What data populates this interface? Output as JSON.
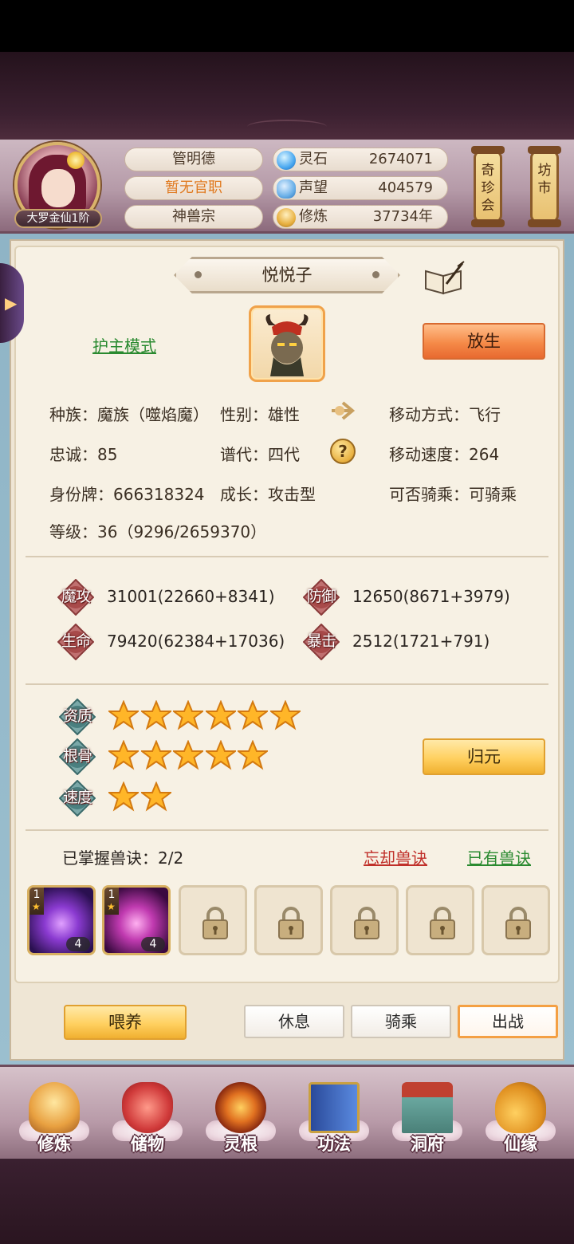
{
  "header": {
    "rank_badge": "大罗金仙1阶",
    "player_name": "管明德",
    "official_post": "暂无官职",
    "sect": "神兽宗",
    "resources": [
      {
        "icon": "spirit-stone-icon",
        "label": "灵石",
        "value": "2674071"
      },
      {
        "icon": "reputation-icon",
        "label": "声望",
        "value": "404579"
      },
      {
        "icon": "cultivation-icon",
        "label": "修炼",
        "value": "37734年"
      }
    ],
    "lantern_treasure": "奇珍会",
    "lantern_market": "坊市"
  },
  "pet": {
    "name": "悦悦子",
    "guard_mode": "护主模式",
    "release_label": "放生",
    "info": {
      "race": "种族：魔族（噬焰魔）",
      "gender": "性别：雄性",
      "move_type": "移动方式：飞行",
      "loyalty": "忠诚：85",
      "generation": "谱代：四代",
      "move_speed": "移动速度：264",
      "id_tag": "身份牌：666318324",
      "growth": "成长：攻击型",
      "rideable": "可否骑乘：可骑乘",
      "level": "等级：36（9296/2659370）"
    },
    "help_icon": "?",
    "stats": [
      {
        "badge": "魔攻",
        "value": "31001(22660+8341)"
      },
      {
        "badge": "防御",
        "value": "12650(8671+3979)"
      },
      {
        "badge": "生命",
        "value": "79420(62384+17036)"
      },
      {
        "badge": "暴击",
        "value": "2512(1721+791)"
      }
    ],
    "ratings": [
      {
        "badge": "资质",
        "stars": 6
      },
      {
        "badge": "根骨",
        "stars": 5
      },
      {
        "badge": "速度",
        "stars": 2
      }
    ],
    "return_label": "归元",
    "skills_learned": "已掌握兽诀：2/2",
    "forget_label": "忘却兽诀",
    "owned_label": "已有兽诀",
    "skills": [
      {
        "level": "1",
        "count": "4"
      },
      {
        "level": "1",
        "count": "4"
      }
    ],
    "locked_slots": 5
  },
  "actions": {
    "feed": "喂养",
    "rest": "休息",
    "ride": "骑乘",
    "battle": "出战"
  },
  "nav": [
    {
      "label": "修炼",
      "icon": "cultivate-icon"
    },
    {
      "label": "储物",
      "icon": "storage-bag-icon"
    },
    {
      "label": "灵根",
      "icon": "spirit-root-icon"
    },
    {
      "label": "功法",
      "icon": "technique-book-icon"
    },
    {
      "label": "洞府",
      "icon": "cave-dwelling-icon"
    },
    {
      "label": "仙缘",
      "icon": "immortal-fate-icon"
    }
  ],
  "colors": {
    "accent_orange": "#f58a48",
    "accent_gold": "#ffd060",
    "link_green": "#2a8a30",
    "link_red": "#c0302a"
  }
}
